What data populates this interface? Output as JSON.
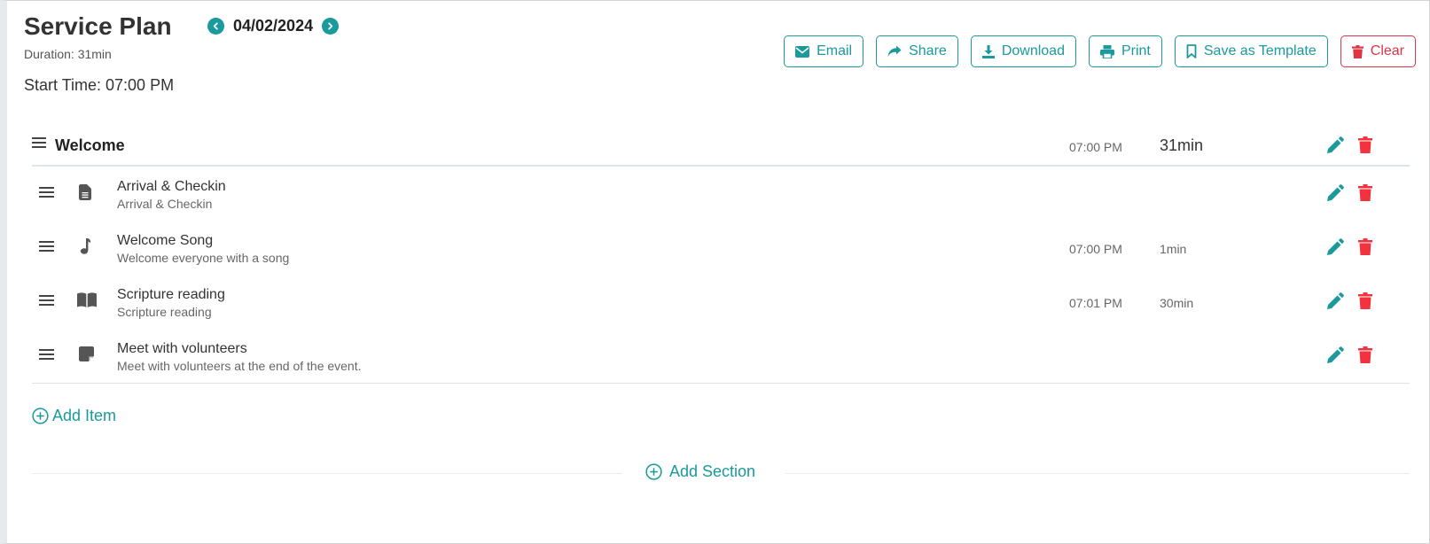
{
  "header": {
    "title": "Service Plan",
    "date": "04/02/2024",
    "duration": "Duration: 31min",
    "start_time": "Start Time: 07:00 PM"
  },
  "toolbar": {
    "email": "Email",
    "share": "Share",
    "download": "Download",
    "print": "Print",
    "save_template": "Save as Template",
    "clear": "Clear"
  },
  "section": {
    "title": "Welcome",
    "time": "07:00 PM",
    "duration": "31min"
  },
  "items": [
    {
      "icon": "document-icon",
      "title": "Arrival & Checkin",
      "description": "Arrival & Checkin",
      "time": "",
      "duration": ""
    },
    {
      "icon": "music-note-icon",
      "title": "Welcome Song",
      "description": "Welcome everyone with a song",
      "time": "07:00 PM",
      "duration": "1min"
    },
    {
      "icon": "book-icon",
      "title": "Scripture reading",
      "description": "Scripture reading",
      "time": "07:01 PM",
      "duration": "30min"
    },
    {
      "icon": "sticky-note-icon",
      "title": "Meet with volunteers",
      "description": "Meet with volunteers at the end of the event.",
      "time": "",
      "duration": ""
    }
  ],
  "actions": {
    "add_item": "Add Item",
    "add_section": "Add Section"
  },
  "colors": {
    "accent": "#1a9a9c",
    "danger": "#dc3545",
    "delete_icon": "#f2323f"
  }
}
